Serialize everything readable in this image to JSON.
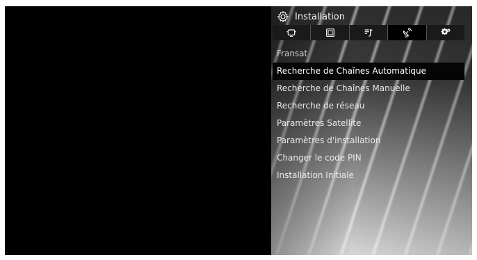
{
  "menu": {
    "title": "Installation",
    "title_icon": "gear-icon",
    "tabs": [
      {
        "icon": "tv-source-icon",
        "active": false
      },
      {
        "icon": "picture-icon",
        "active": false
      },
      {
        "icon": "sound-icon",
        "active": false
      },
      {
        "icon": "satellite-icon",
        "active": true
      },
      {
        "icon": "settings-icon",
        "active": false
      }
    ],
    "items": [
      {
        "label": "Fransat"
      },
      {
        "label": "Recherche de Chaînes Automatique"
      },
      {
        "label": "Recherche de Chaînes Manuelle"
      },
      {
        "label": "Recherche de réseau"
      },
      {
        "label": "Paramètres Satellite"
      },
      {
        "label": "Paramètres d'installation"
      },
      {
        "label": "Changer le code PIN"
      },
      {
        "label": "Installation Initiale"
      }
    ],
    "selected_index": 1
  },
  "colors": {
    "video_background": "#000000",
    "selection_bar": "#050505",
    "text": "#e8e8e8"
  }
}
